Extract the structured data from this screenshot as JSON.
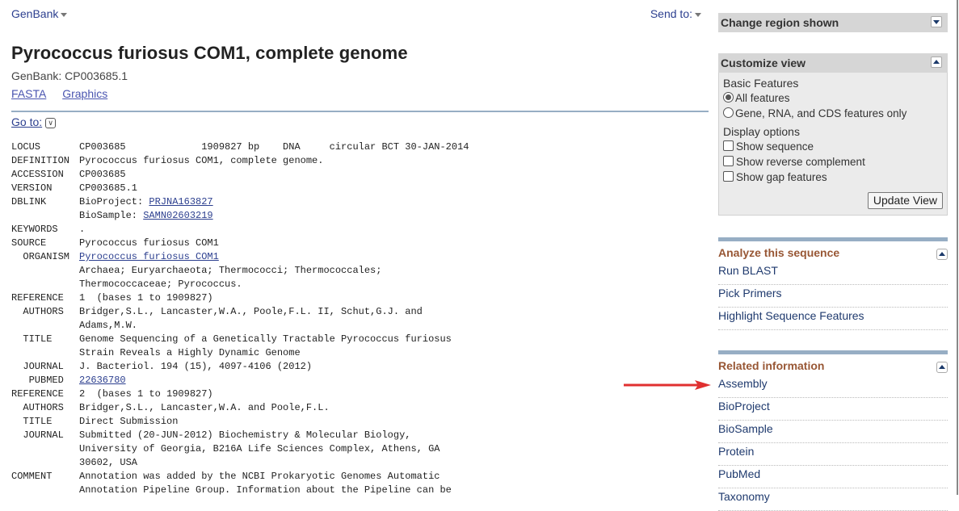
{
  "topbar": {
    "database": "GenBank",
    "send_to": "Send to:"
  },
  "record": {
    "title": "Pyrococcus furiosus COM1, complete genome",
    "accession_line": "GenBank: CP003685.1",
    "links": [
      "FASTA",
      "Graphics"
    ],
    "goto_label": "Go to:"
  },
  "flatfile": [
    {
      "key": "LOCUS",
      "value": "CP003685             1909827 bp    DNA     circular BCT 30-JAN-2014"
    },
    {
      "key": "DEFINITION",
      "value": "Pyrococcus furiosus COM1, complete genome."
    },
    {
      "key": "ACCESSION",
      "value": "CP003685"
    },
    {
      "key": "VERSION",
      "value": "CP003685.1"
    },
    {
      "key": "DBLINK",
      "prefix": "BioProject: ",
      "link": "PRJNA163827"
    },
    {
      "key": "",
      "prefix": "BioSample: ",
      "link": "SAMN02603219"
    },
    {
      "key": "KEYWORDS",
      "value": "."
    },
    {
      "key": "SOURCE",
      "value": "Pyrococcus furiosus COM1"
    },
    {
      "key": "  ORGANISM",
      "link": "Pyrococcus furiosus COM1"
    },
    {
      "key": "",
      "value": "Archaea; Euryarchaeota; Thermococci; Thermococcales;"
    },
    {
      "key": "",
      "value": "Thermococcaceae; Pyrococcus."
    },
    {
      "key": "REFERENCE",
      "value": "1  (bases 1 to 1909827)"
    },
    {
      "key": "  AUTHORS",
      "value": "Bridger,S.L., Lancaster,W.A., Poole,F.L. II, Schut,G.J. and"
    },
    {
      "key": "",
      "value": "Adams,M.W."
    },
    {
      "key": "  TITLE",
      "value": "Genome Sequencing of a Genetically Tractable Pyrococcus furiosus"
    },
    {
      "key": "",
      "value": "Strain Reveals a Highly Dynamic Genome"
    },
    {
      "key": "  JOURNAL",
      "value": "J. Bacteriol. 194 (15), 4097-4106 (2012)"
    },
    {
      "key": "   PUBMED",
      "link": "22636780"
    },
    {
      "key": "REFERENCE",
      "value": "2  (bases 1 to 1909827)"
    },
    {
      "key": "  AUTHORS",
      "value": "Bridger,S.L., Lancaster,W.A. and Poole,F.L."
    },
    {
      "key": "  TITLE",
      "value": "Direct Submission"
    },
    {
      "key": "  JOURNAL",
      "value": "Submitted (20-JUN-2012) Biochemistry & Molecular Biology,"
    },
    {
      "key": "",
      "value": "University of Georgia, B216A Life Sciences Complex, Athens, GA"
    },
    {
      "key": "",
      "value": "30602, USA"
    },
    {
      "key": "COMMENT",
      "value": "Annotation was added by the NCBI Prokaryotic Genomes Automatic"
    },
    {
      "key": "",
      "value": "Annotation Pipeline Group. Information about the Pipeline can be"
    }
  ],
  "sidebar": {
    "change_region": {
      "title": "Change region shown"
    },
    "customize": {
      "title": "Customize view",
      "basic_features_label": "Basic Features",
      "radio_options": [
        {
          "label": "All features",
          "selected": true
        },
        {
          "label": "Gene, RNA, and CDS features only",
          "selected": false
        }
      ],
      "display_options_label": "Display options",
      "checkboxes": [
        {
          "label": "Show sequence",
          "checked": false
        },
        {
          "label": "Show reverse complement",
          "checked": false
        },
        {
          "label": "Show gap features",
          "checked": false
        }
      ],
      "update_button": "Update View"
    },
    "analyze": {
      "title": "Analyze this sequence",
      "items": [
        "Run BLAST",
        "Pick Primers",
        "Highlight Sequence Features"
      ]
    },
    "related": {
      "title": "Related information",
      "items": [
        "Assembly",
        "BioProject",
        "BioSample",
        "Protein",
        "PubMed",
        "Taxonomy"
      ]
    }
  },
  "annotation": {
    "arrow_color": "#e03030",
    "points_to": "Assembly"
  }
}
